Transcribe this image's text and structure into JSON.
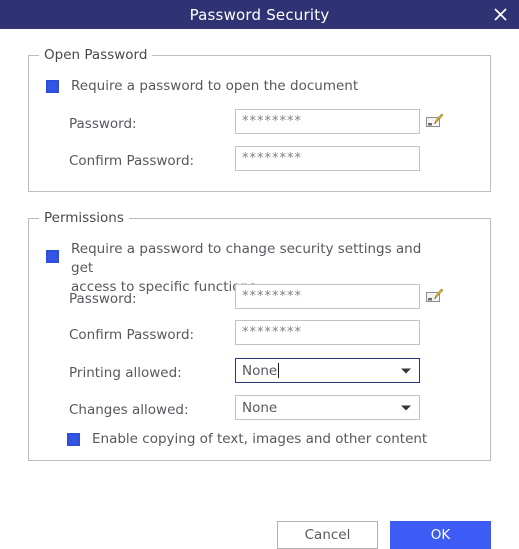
{
  "window": {
    "title": "Password Security",
    "close_icon": "close-icon"
  },
  "open_password_group": {
    "legend": "Open Password",
    "require_checkbox": {
      "label": "Require a password to open the document",
      "checked": true
    },
    "password": {
      "label": "Password:",
      "value": "********",
      "edit_icon": "pencil-edit-icon"
    },
    "confirm_password": {
      "label": "Confirm Password:",
      "value": "********"
    }
  },
  "permissions_group": {
    "legend": "Permissions",
    "require_checkbox": {
      "label": "Require a password to change security settings and get\naccess to specific functions",
      "checked": true
    },
    "password": {
      "label": "Password:",
      "value": "********",
      "edit_icon": "pencil-edit-icon"
    },
    "confirm_password": {
      "label": "Confirm Password:",
      "value": "********"
    },
    "printing_allowed": {
      "label": "Printing allowed:",
      "value": "None",
      "focused": true
    },
    "changes_allowed": {
      "label": "Changes allowed:",
      "value": "None",
      "focused": false
    },
    "enable_copying_checkbox": {
      "label": "Enable copying of text, images and other content",
      "checked": true
    }
  },
  "footer": {
    "cancel_label": "Cancel",
    "ok_label": "OK"
  },
  "colors": {
    "titlebar": "#2f3373",
    "accent_blue": "#3d5cf5",
    "checkbox_blue": "#3554e4",
    "border_gray": "#c3c3c3",
    "text_gray": "#55595e"
  }
}
